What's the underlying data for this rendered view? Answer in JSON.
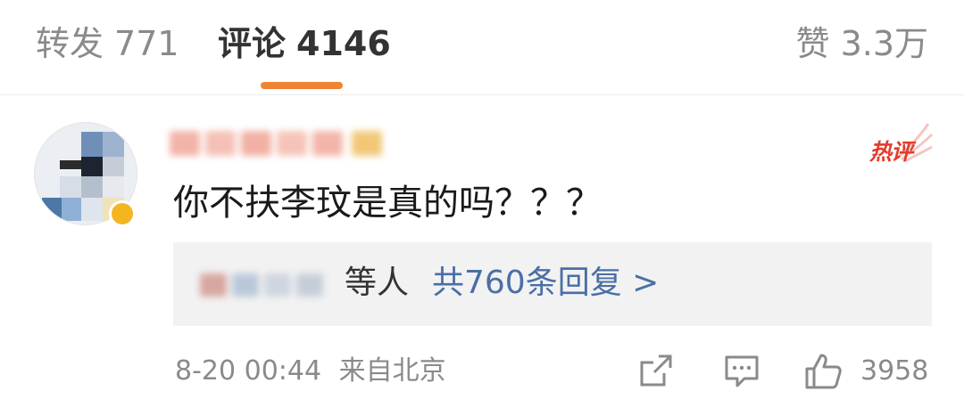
{
  "tabs": {
    "repost": {
      "label": "转发",
      "count": "771"
    },
    "comment": {
      "label": "评论",
      "count": "4146"
    },
    "like": {
      "label": "赞",
      "count": "3.3万"
    }
  },
  "comment": {
    "username_label": "",
    "hot_badge": "热评",
    "text": "你不扶李玟是真的吗？？？",
    "replies": {
      "names_suffix": "等人",
      "count_label": "共760条回复 >"
    },
    "timestamp": "8-20 00:44",
    "location": "来自北京",
    "like_count": "3958",
    "icons": [
      "share-icon",
      "comment-icon",
      "thumbs-up-icon"
    ],
    "colors": {
      "accent": "#ef8433",
      "hot": "#e23c2c",
      "link": "#4a6fa5"
    }
  }
}
